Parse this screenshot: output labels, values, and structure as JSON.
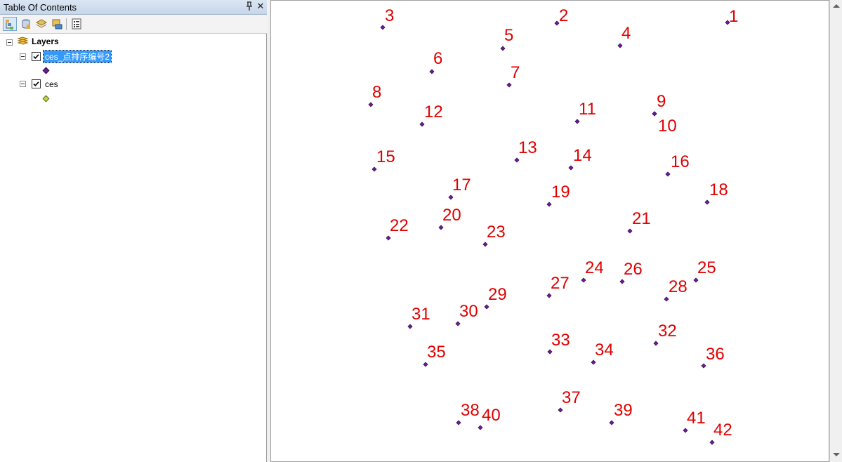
{
  "toc": {
    "title": "Table Of Contents",
    "pin_glyph": "ᵖ",
    "close_glyph": "✕",
    "tools": [
      "list-by-drawing-order-icon",
      "list-by-source-icon",
      "list-by-visibility-icon",
      "list-by-selection-icon",
      "options-icon"
    ],
    "root_label": "Layers",
    "layers": [
      {
        "name": "ces_点排序编号2",
        "checked": true,
        "selected": true,
        "symbol_color": "#6a1b9a"
      },
      {
        "name": "ces",
        "checked": true,
        "selected": false,
        "symbol_color": "#c6d64a"
      }
    ]
  },
  "map": {
    "label_color": "#e00000",
    "point_color": "#6a1b9a",
    "points": [
      {
        "label": "1"
      },
      {
        "label": "2"
      },
      {
        "label": "3"
      },
      {
        "label": "4"
      },
      {
        "label": "5"
      },
      {
        "label": "6"
      },
      {
        "label": "7"
      },
      {
        "label": "8"
      },
      {
        "label": "9"
      },
      {
        "label": "10"
      },
      {
        "label": "11"
      },
      {
        "label": "12"
      },
      {
        "label": "13"
      },
      {
        "label": "14"
      },
      {
        "label": "15"
      },
      {
        "label": "16"
      },
      {
        "label": "17"
      },
      {
        "label": "18"
      },
      {
        "label": "19"
      },
      {
        "label": "20"
      },
      {
        "label": "21"
      },
      {
        "label": "22"
      },
      {
        "label": "23"
      },
      {
        "label": "24"
      },
      {
        "label": "25"
      },
      {
        "label": "26"
      },
      {
        "label": "27"
      },
      {
        "label": "28"
      },
      {
        "label": "29"
      },
      {
        "label": "30"
      },
      {
        "label": "31"
      },
      {
        "label": "32"
      },
      {
        "label": "33"
      },
      {
        "label": "34"
      },
      {
        "label": "35"
      },
      {
        "label": "36"
      },
      {
        "label": "37"
      },
      {
        "label": "38"
      },
      {
        "label": "39"
      },
      {
        "label": "40"
      },
      {
        "label": "41"
      },
      {
        "label": "42"
      }
    ]
  }
}
